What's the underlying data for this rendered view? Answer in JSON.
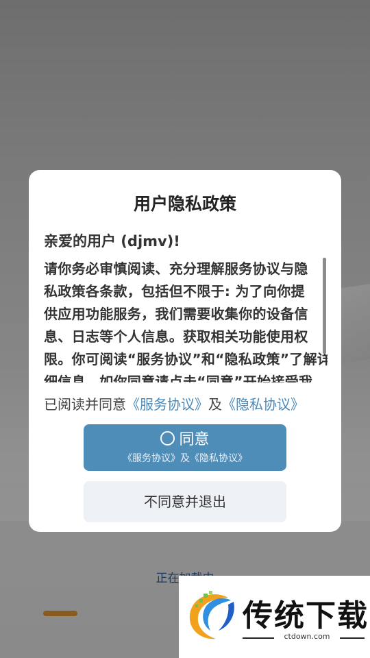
{
  "background": {
    "loading_text": "正在加载中",
    "progress": 0.12
  },
  "dialog": {
    "title": "用户隐私政策",
    "greeting": "亲爱的用户 (djmv)!",
    "body_lines": [
      "请你务必审慎阅读、充分理解服务协议与隐",
      "私政策各条款，包括但不限于: 为了向你提",
      "供应用功能服务，我们需要收集你的设备信",
      "息、日志等个人信息。获取相关功能使用权",
      "限。你可阅读“服务协议”和“隐私政策”了解详",
      "细信息。如你同意请点击“同意”开始接受我"
    ],
    "agree_line": {
      "prefix": "已阅读并同意",
      "service_link": "《服务协议》",
      "conjunction": "及",
      "privacy_link": "《隐私协议》"
    },
    "agree_button": {
      "label": "同意",
      "sublabel": "《服务协议》及《隐私协议》"
    },
    "disagree_button": {
      "label": "不同意并退出"
    }
  },
  "watermark": {
    "title": "传统下载",
    "url": "ctdown.com"
  },
  "colors": {
    "accent": "#4f8db9",
    "link": "#4a88b8",
    "progress": "#8a5a1e"
  }
}
